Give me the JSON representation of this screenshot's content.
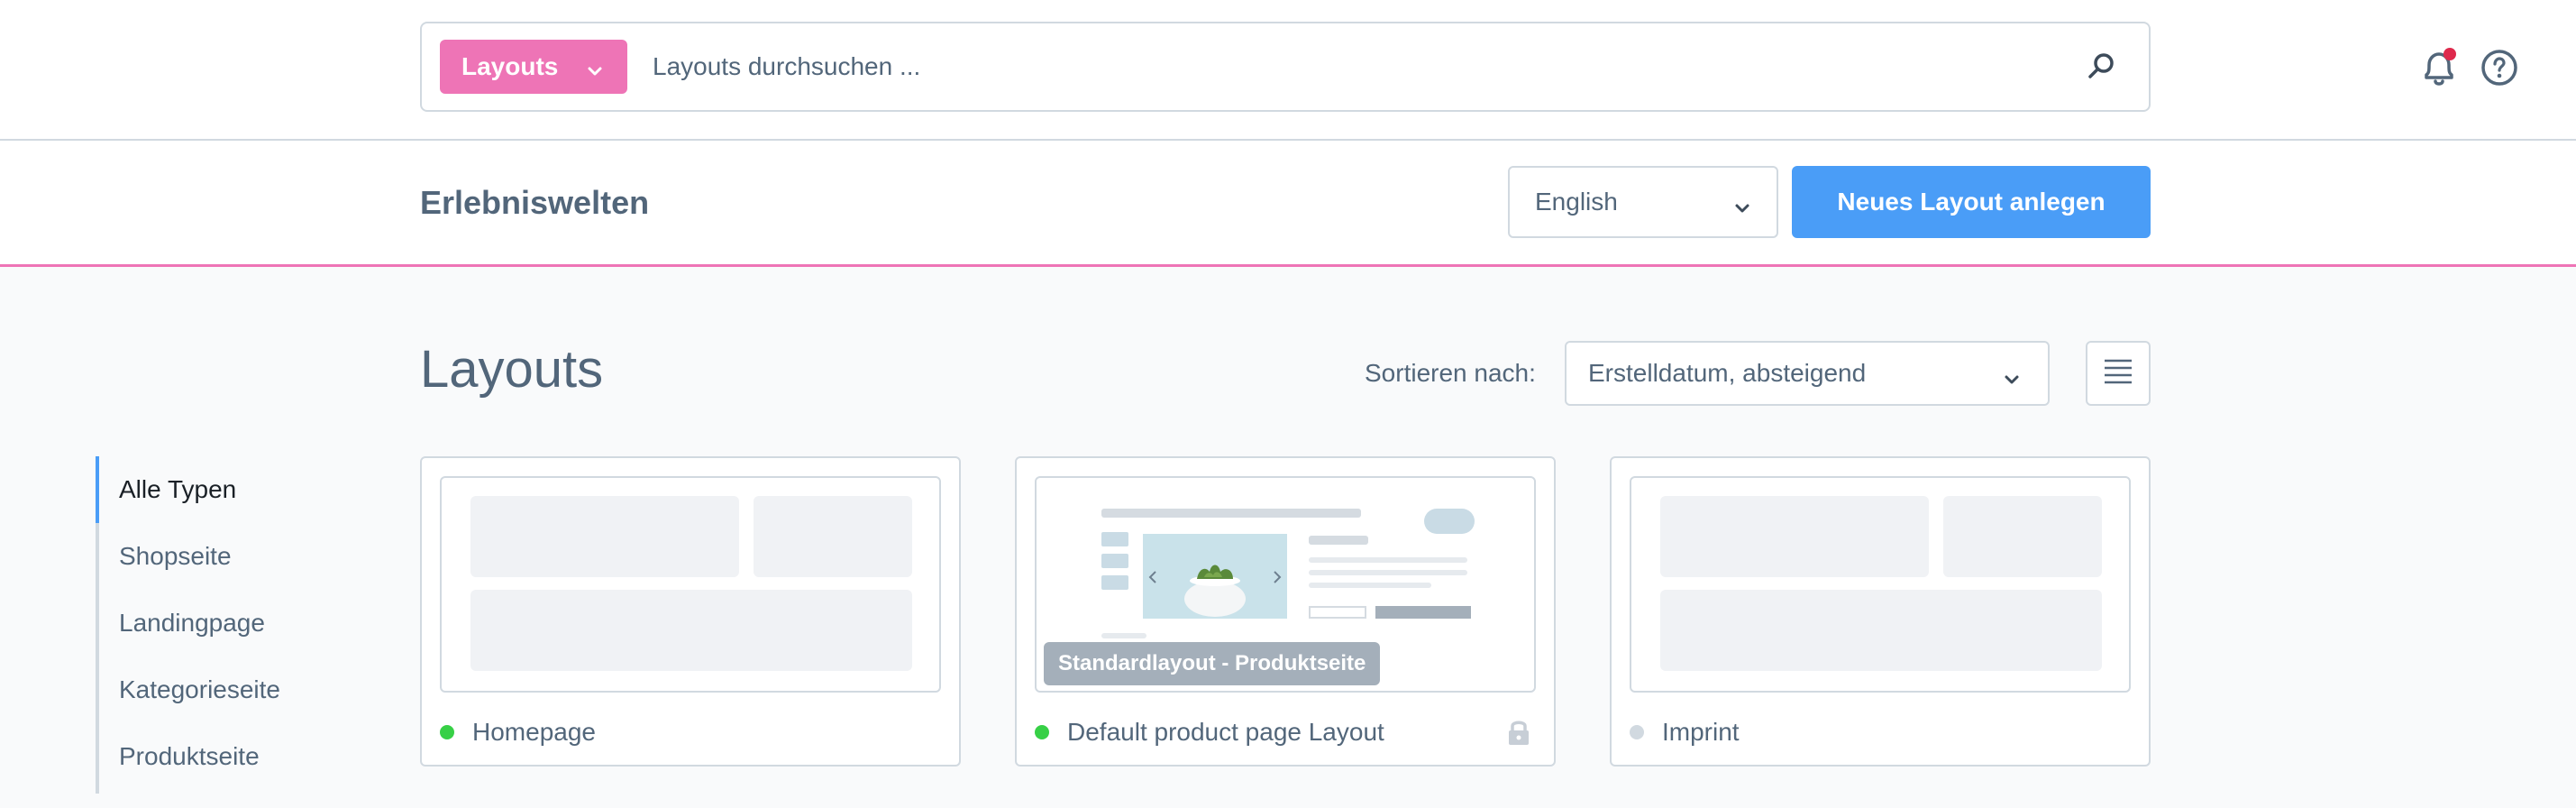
{
  "search": {
    "type_label": "Layouts",
    "placeholder": "Layouts durchsuchen ..."
  },
  "smartbar": {
    "title": "Erlebniswelten",
    "language": "English",
    "new_button": "Neues Layout anlegen"
  },
  "content": {
    "heading": "Layouts",
    "sort_label": "Sortieren nach:",
    "sort_value": "Erstelldatum, absteigend"
  },
  "sidebar": {
    "items": [
      {
        "label": "Alle Typen"
      },
      {
        "label": "Shopseite"
      },
      {
        "label": "Landingpage"
      },
      {
        "label": "Kategorieseite"
      },
      {
        "label": "Produktseite"
      }
    ]
  },
  "cards": [
    {
      "name": "Homepage",
      "status": "active",
      "status_color": "#37d046"
    },
    {
      "name": "Default product page Layout",
      "status": "active",
      "status_color": "#37d046",
      "badge": "Standardlayout - Produktseite",
      "locked": true
    },
    {
      "name": "Imprint",
      "status": "inactive",
      "status_color": "#d1d9e0"
    }
  ],
  "colors": {
    "accent_pink": "#ee74b6",
    "primary_blue": "#4a9df7",
    "notification_dot": "#de294c"
  },
  "icons": {
    "search": "search-icon",
    "bell": "bell-icon",
    "help": "help-icon",
    "list_view": "list-view-icon",
    "lock": "lock-icon"
  }
}
